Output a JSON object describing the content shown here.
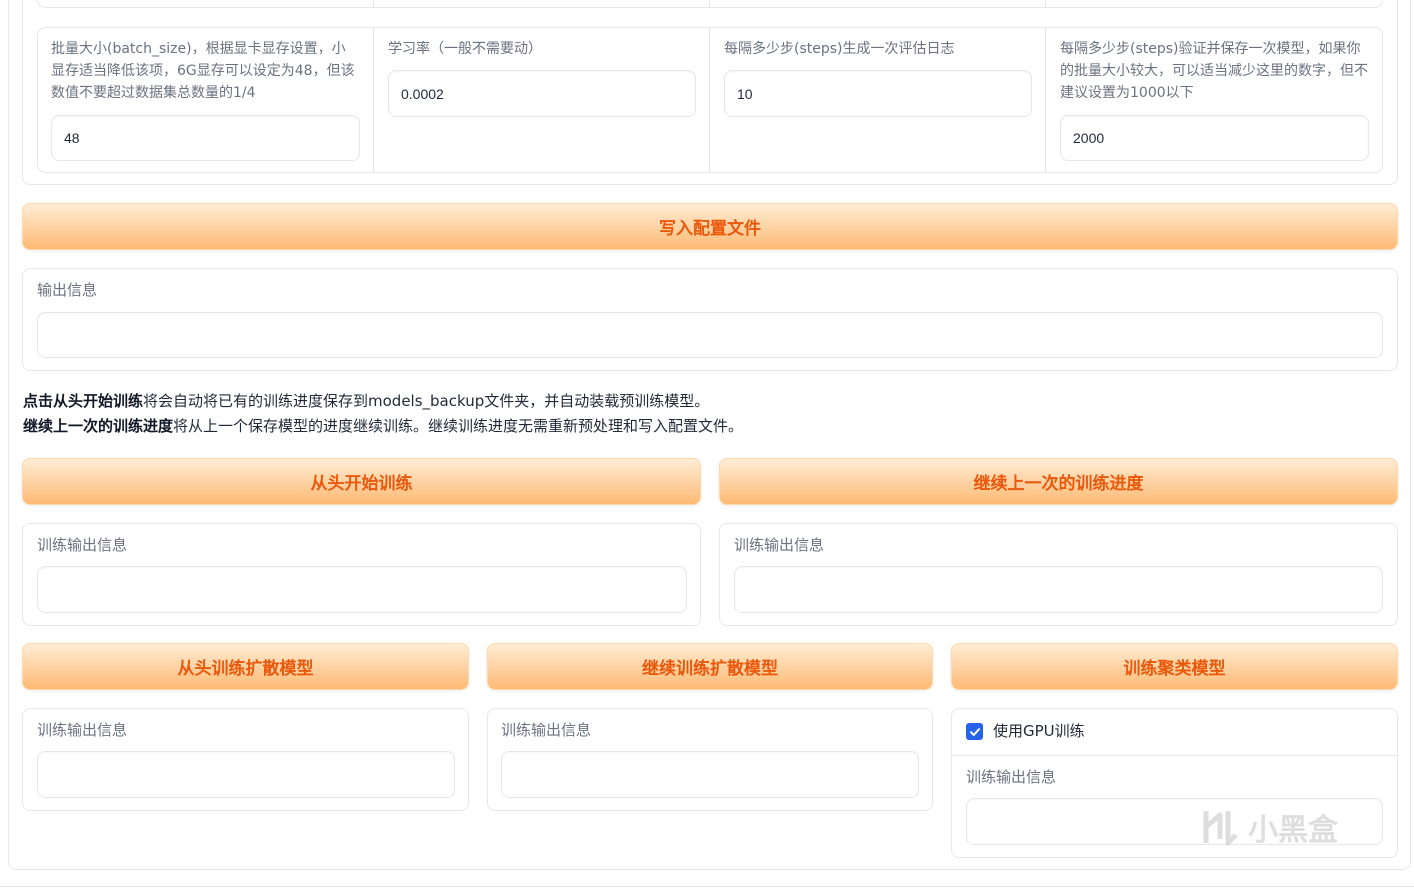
{
  "config": {
    "batch_size": {
      "label": "批量大小(batch_size)，根据显卡显存设置，小显存适当降低该项，6G显存可以设定为48，但该数值不要超过数据集总数量的1/4",
      "value": "48"
    },
    "learning_rate": {
      "label": "学习率（一般不需要动）",
      "value": "0.0002"
    },
    "log_interval": {
      "label": "每隔多少步(steps)生成一次评估日志",
      "value": "10"
    },
    "save_interval": {
      "label": "每隔多少步(steps)验证并保存一次模型，如果你的批量大小较大，可以适当减少这里的数字，但不建议设置为1000以下",
      "value": "2000"
    }
  },
  "write_config_button": "写入配置文件",
  "output_info": {
    "label": "输出信息",
    "value": ""
  },
  "instructions": {
    "line1_bold": "点击从头开始训练",
    "line1_rest": "将会自动将已有的训练进度保存到models_backup文件夹，并自动装载预训练模型。",
    "line2_bold": "继续上一次的训练进度",
    "line2_rest": "将从上一个保存模型的进度继续训练。继续训练进度无需重新预处理和写入配置文件。"
  },
  "train_buttons": {
    "from_scratch": "从头开始训练",
    "continue": "继续上一次的训练进度"
  },
  "train_outputs": {
    "left_label": "训练输出信息",
    "right_label": "训练输出信息"
  },
  "diffusion_buttons": {
    "from_scratch": "从头训练扩散模型",
    "continue": "继续训练扩散模型",
    "cluster": "训练聚类模型"
  },
  "diffusion_outputs": {
    "col1_label": "训练输出信息",
    "col2_label": "训练输出信息",
    "col3_label": "训练输出信息"
  },
  "gpu_checkbox": {
    "label": "使用GPU训练",
    "checked": true
  },
  "watermark": "小黑盒"
}
